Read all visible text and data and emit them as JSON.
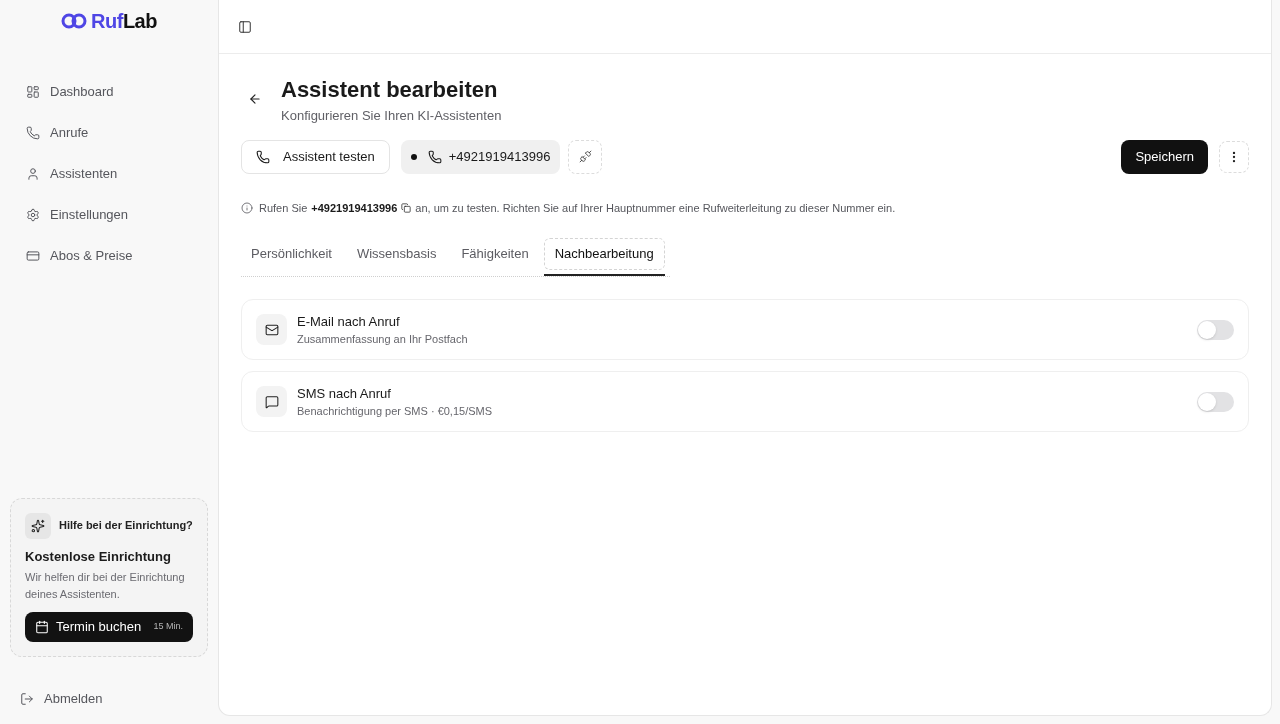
{
  "logo": {
    "accent": "Ruf",
    "rest": "Lab"
  },
  "sidebar": {
    "items": [
      {
        "label": "Dashboard"
      },
      {
        "label": "Anrufe"
      },
      {
        "label": "Assistenten"
      },
      {
        "label": "Einstellungen"
      },
      {
        "label": "Abos & Preise"
      }
    ]
  },
  "help_card": {
    "heading": "Hilfe bei der Einrichtung?",
    "title": "Kostenlose Einrichtung",
    "description": "Wir helfen dir bei der Einrichtung deines Assistenten.",
    "button": {
      "label": "Termin buchen",
      "duration": "15 Min."
    }
  },
  "logout": {
    "label": "Abmelden"
  },
  "page": {
    "title": "Assistent bearbeiten",
    "subtitle": "Konfigurieren Sie Ihren KI-Assistenten"
  },
  "actions": {
    "test_button": "Assistent testen",
    "number_button": "+4921919413996",
    "save_button": "Speichern"
  },
  "info": {
    "before": "Rufen Sie",
    "number": "+4921919413996",
    "after": "an, um zu testen. Richten Sie auf Ihrer Hauptnummer eine Rufweiterleitung zu dieser Nummer ein."
  },
  "tabs": [
    {
      "label": "Persönlichkeit",
      "selected": false
    },
    {
      "label": "Wissensbasis",
      "selected": false
    },
    {
      "label": "Fähigkeiten",
      "selected": false
    },
    {
      "label": "Nachbearbeitung",
      "selected": true
    }
  ],
  "settings": [
    {
      "title": "E-Mail nach Anruf",
      "description": "Zusammenfassung an Ihr Postfach",
      "on": false
    },
    {
      "title": "SMS nach Anruf",
      "description": "Benachrichtigung per SMS · €0,15/SMS",
      "on": false
    }
  ]
}
